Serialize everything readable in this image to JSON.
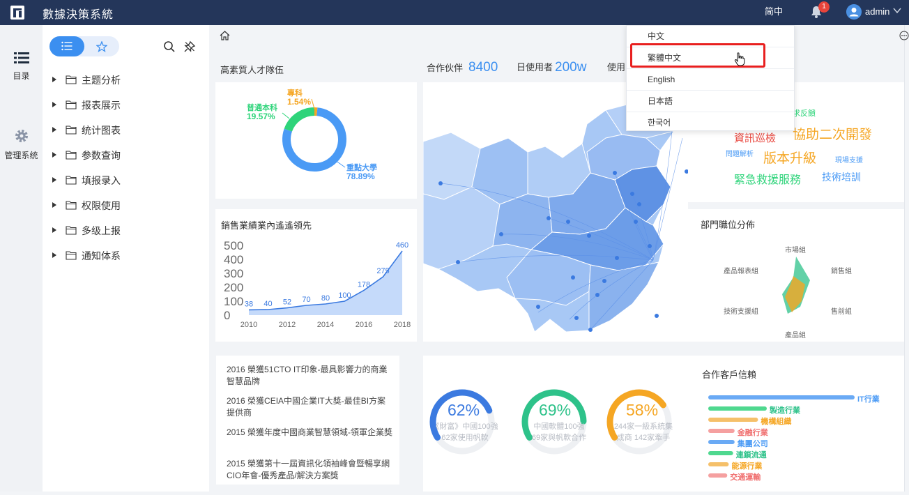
{
  "app": {
    "title": "數據決策系統",
    "lang_current": "简中",
    "bell_count": "1",
    "username": "admin"
  },
  "rail": {
    "catalog": "目录",
    "admin": "管理系统"
  },
  "sidebar": {
    "items": [
      "主题分析",
      "报表展示",
      "统计图表",
      "参数查询",
      "填报录入",
      "权限使用",
      "多级上报",
      "通知体系"
    ]
  },
  "kpis": [
    {
      "label": "合作伙伴",
      "value": "8400"
    },
    {
      "label": "日使用者",
      "value": "200w"
    },
    {
      "label": "使用",
      "value": ""
    }
  ],
  "language_menu": {
    "items": [
      "中文",
      "繁體中文",
      "English",
      "日本語",
      "한국어"
    ],
    "hover": "繁體中文"
  },
  "donut": {
    "title": "高素質人才隊伍",
    "segments": [
      {
        "name": "重點大學",
        "pct": "78.89%",
        "value": 78.89,
        "color": "#4a9af5"
      },
      {
        "name": "普通本科",
        "pct": "19.57%",
        "value": 19.57,
        "color": "#2ed47a"
      },
      {
        "name": "專科",
        "pct": "1.54%",
        "value": 1.54,
        "color": "#f5a623"
      }
    ]
  },
  "chart_data": {
    "type": "area",
    "title": "銷售業績業內遙遙領先",
    "x": [
      "2010",
      "2011",
      "2012",
      "2013",
      "2014",
      "2015",
      "2016",
      "2017",
      "2018"
    ],
    "xticks": [
      "2010",
      "2012",
      "2014",
      "2016",
      "2018"
    ],
    "values": [
      38,
      40,
      52,
      70,
      80,
      100,
      178,
      275,
      460
    ],
    "yticks": [
      "0",
      "100",
      "200",
      "300",
      "400",
      "500"
    ],
    "ylim": [
      0,
      500
    ],
    "color": "#3b7ae0"
  },
  "awards": [
    "2016 榮獲51CTO IT印象-最具影響力的商業智慧品牌",
    "2016 榮獲CEIA中國企業IT大獎-最佳BI方案提供商",
    "2015 榮獲年度中國商業智慧領域-領軍企業獎",
    "2015 榮獲第十一屆資訊化領袖峰會暨暢享網CIO年會-優秀產品/解決方案獎"
  ],
  "rings": [
    {
      "pct": "62%",
      "value": 62,
      "line1": "《財富》中國100強",
      "line2": "62家使用帆軟",
      "color": "#3b7ae0"
    },
    {
      "pct": "69%",
      "value": 69,
      "line1": "中國軟體100強",
      "line2": "69家與帆軟合作",
      "color": "#2ec28a"
    },
    {
      "pct": "58%",
      "value": 58,
      "line1": "244家一級系統集",
      "line2": "成商 142家牽手",
      "color": "#f5a623"
    }
  ],
  "wordcloud": [
    {
      "text": "求反饋",
      "color": "#2ed47a"
    },
    {
      "text": "資訊巡檢",
      "color": "#e8443b"
    },
    {
      "text": "協助二次開發",
      "color": "#f5a623"
    },
    {
      "text": "問題解析",
      "color": "#4a9af5"
    },
    {
      "text": "版本升級",
      "color": "#f5a623"
    },
    {
      "text": "現場支援",
      "color": "#4a9af5"
    },
    {
      "text": "緊急救援服務",
      "color": "#2ed47a"
    },
    {
      "text": "技術培訓",
      "color": "#4a9af5"
    }
  ],
  "radar": {
    "title": "部門職位分佈",
    "axes": [
      "市場組",
      "銷售組",
      "售前組",
      "產品組",
      "技術支援組",
      "產品報表組"
    ]
  },
  "industries": {
    "title": "合作客戶信賴",
    "items": [
      {
        "name": "IT行業",
        "value": 100,
        "color": "#6aaaf5"
      },
      {
        "name": "製造行業",
        "value": 40,
        "color": "#4fd88f"
      },
      {
        "name": "機構組織",
        "value": 34,
        "color": "#f5c06a"
      },
      {
        "name": "金融行業",
        "value": 18,
        "color": "#f5a0a0"
      },
      {
        "name": "集團公司",
        "value": 18,
        "color": "#6aaaf5"
      },
      {
        "name": "連鎖流通",
        "value": 17,
        "color": "#4fd88f"
      },
      {
        "name": "能源行業",
        "value": 14,
        "color": "#f5c06a"
      },
      {
        "name": "交通運輸",
        "value": 13,
        "color": "#f5a0a0"
      }
    ]
  }
}
